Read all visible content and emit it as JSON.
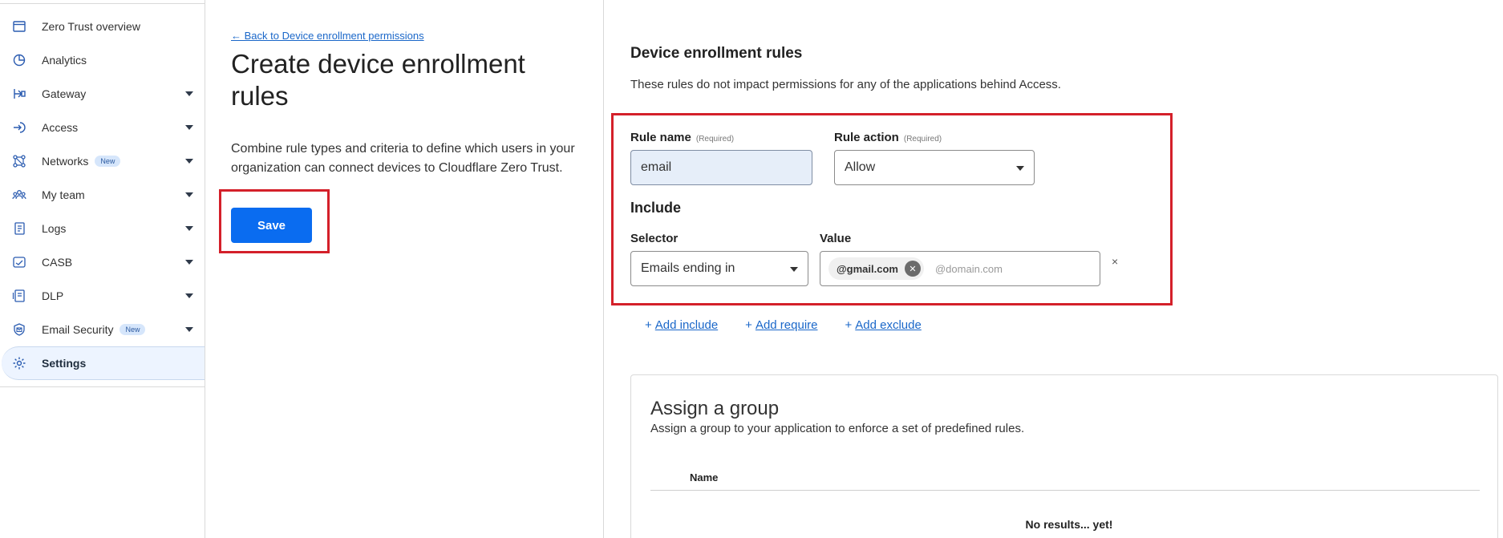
{
  "sidebar": {
    "items": [
      {
        "label": "Zero Trust overview",
        "icon": "window-icon",
        "caret": false,
        "badge": ""
      },
      {
        "label": "Analytics",
        "icon": "chart-pie-icon",
        "caret": false,
        "badge": ""
      },
      {
        "label": "Gateway",
        "icon": "gateway-icon",
        "caret": true,
        "badge": ""
      },
      {
        "label": "Access",
        "icon": "access-icon",
        "caret": true,
        "badge": ""
      },
      {
        "label": "Networks",
        "icon": "network-icon",
        "caret": true,
        "badge": "New"
      },
      {
        "label": "My team",
        "icon": "team-icon",
        "caret": true,
        "badge": ""
      },
      {
        "label": "Logs",
        "icon": "logs-icon",
        "caret": true,
        "badge": ""
      },
      {
        "label": "CASB",
        "icon": "casb-icon",
        "caret": true,
        "badge": ""
      },
      {
        "label": "DLP",
        "icon": "dlp-icon",
        "caret": true,
        "badge": ""
      },
      {
        "label": "Email Security",
        "icon": "email-security-icon",
        "caret": true,
        "badge": "New"
      },
      {
        "label": "Settings",
        "icon": "gear-icon",
        "caret": false,
        "badge": "",
        "active": true
      }
    ]
  },
  "left": {
    "back_link": "← Back to Device enrollment permissions",
    "title": "Create device enrollment rules",
    "description": "Combine rule types and criteria to define which users in your organization can connect devices to Cloudflare Zero Trust.",
    "save_label": "Save"
  },
  "rules": {
    "title": "Device enrollment rules",
    "description": "These rules do not impact permissions for any of the applications behind Access.",
    "rule_name_label": "Rule name",
    "rule_name_required": "(Required)",
    "rule_name_value": "email",
    "rule_action_label": "Rule action",
    "rule_action_required": "(Required)",
    "rule_action_value": "Allow",
    "include_title": "Include",
    "selector_label": "Selector",
    "selector_value": "Emails ending in",
    "value_label": "Value",
    "value_chip": "@gmail.com",
    "value_placeholder": "@domain.com",
    "remove_symbol": "×",
    "add_include": "Add include",
    "add_require": "Add require",
    "add_exclude": "Add exclude",
    "plus": "+"
  },
  "group": {
    "title": "Assign a group",
    "description": "Assign a group to your application to enforce a set of predefined rules.",
    "column_name": "Name",
    "empty_text": "No results... yet!"
  },
  "colors": {
    "accent": "#0a6cf0",
    "highlight": "#d4202a",
    "link": "#1a67c9"
  }
}
